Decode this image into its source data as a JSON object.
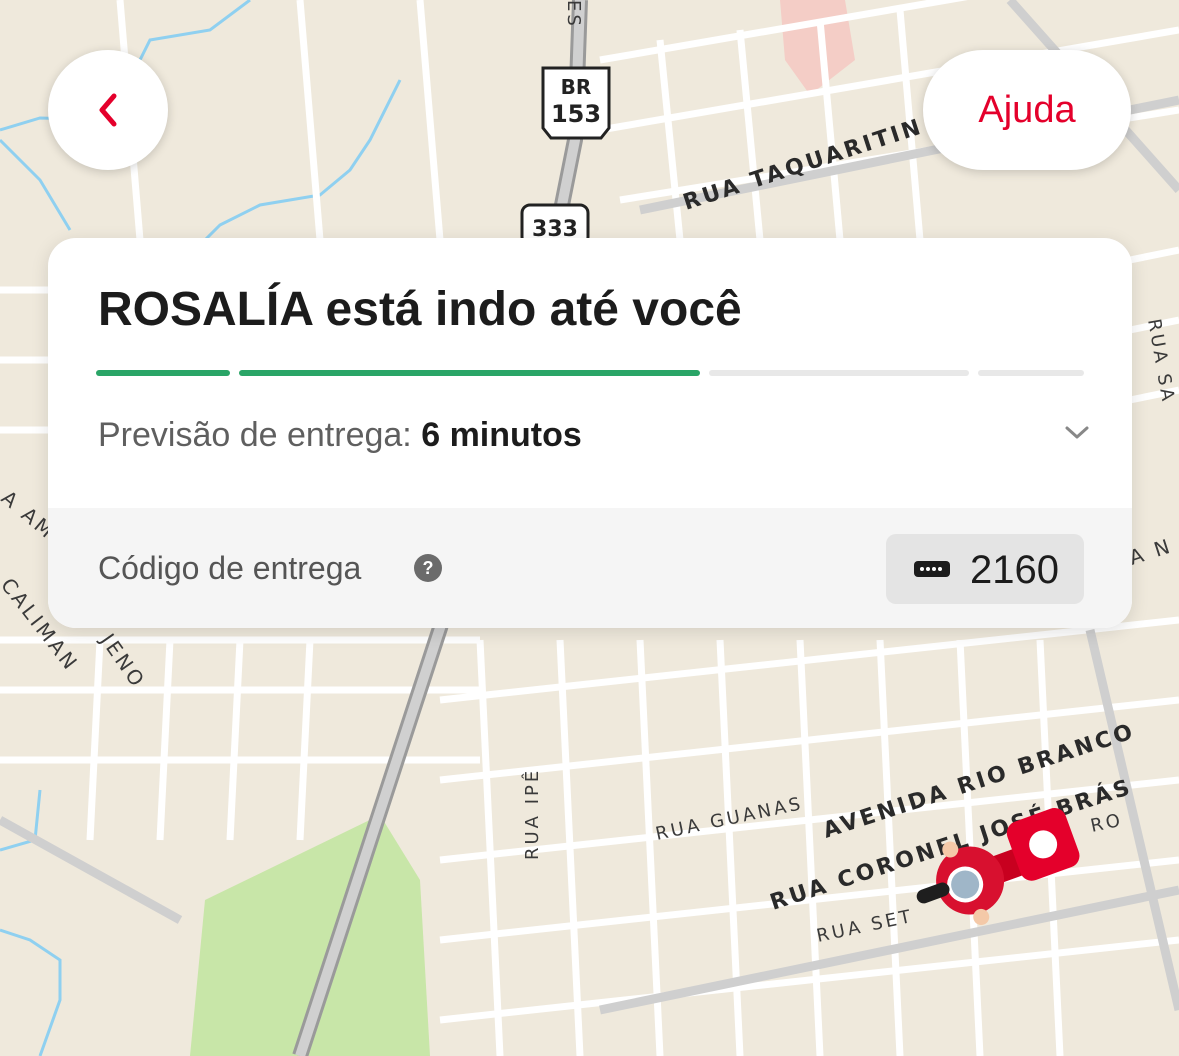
{
  "header": {
    "back_icon": "chevron-left-icon",
    "help_label": "Ajuda"
  },
  "tracking": {
    "title": "ROSALÍA está indo até você",
    "progress_fractions": [
      1,
      1,
      0,
      0
    ],
    "eta_label": "Previsão de entrega:",
    "eta_value": "6 minutos",
    "expand_icon": "chevron-down-icon"
  },
  "delivery_code": {
    "label": "Código de entrega",
    "help_icon": "help-circle-icon",
    "code_icon": "dots-password-icon",
    "value": "2160"
  },
  "map": {
    "highway_shield_top": "BR",
    "highway_shield_number": "153",
    "route_shield": "333",
    "street_labels": [
      "RUA TAQUARITIN",
      "AVENIDA RIO BRANCO",
      "RUA CORONEL JOSÉ BRÁS",
      "RUA GUANAS",
      "RUA IPÊ",
      "RUA SET",
      "RO",
      "RUA SA",
      "CALIMAN",
      "JENO",
      "A AMA",
      "A N",
      "ES"
    ],
    "courier_icon": "delivery-motorcycle-icon"
  },
  "colors": {
    "accent": "#e4002b",
    "progress": "#2aa567",
    "map_background": "#efe9dc",
    "park": "#c8e6a8",
    "water": "#8fd0f0"
  }
}
